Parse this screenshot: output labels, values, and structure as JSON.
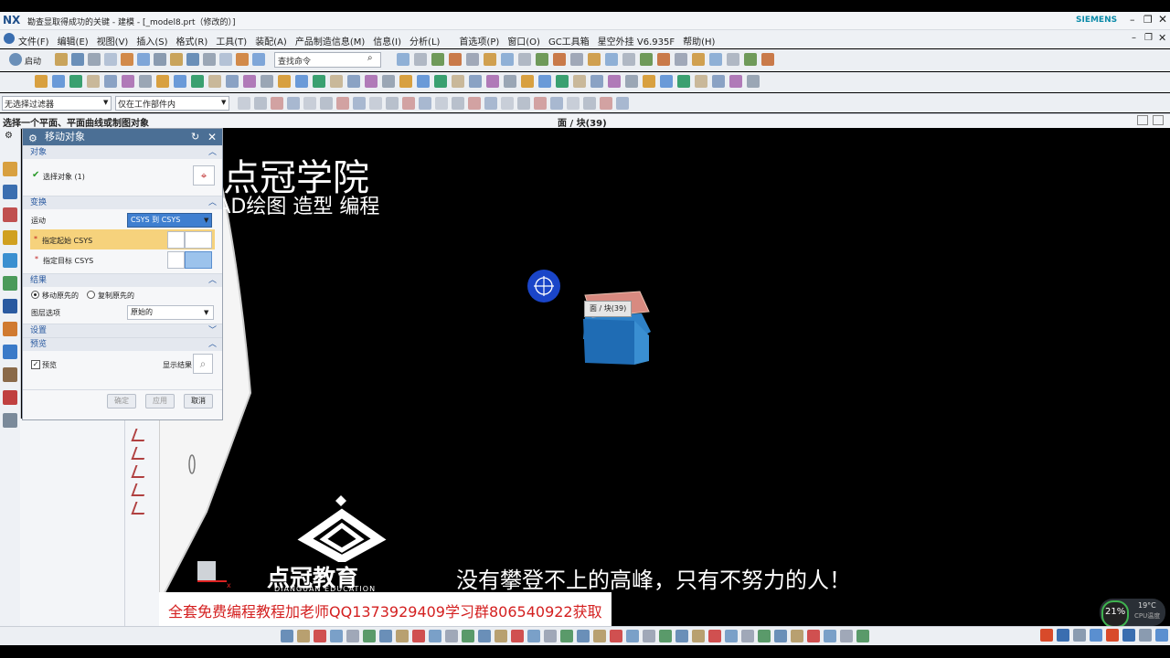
{
  "window": {
    "app_logo": "NX",
    "title": "勘查显取得成功的关键 - 建模 - [_model8.prt（修改的）]",
    "brand": "SIEMENS"
  },
  "menu": {
    "items": [
      "文件(F)",
      "编辑(E)",
      "视图(V)",
      "插入(S)",
      "格式(R)",
      "工具(T)",
      "装配(A)",
      "产品制造信息(M)",
      "信息(I)",
      "分析(L)",
      "首选项(P)",
      "窗口(O)",
      "GC工具箱",
      "星空外挂 V6.935F",
      "帮助(H)"
    ]
  },
  "toolbar": {
    "start_label": "启动",
    "search_placeholder": "查找命令",
    "filter_value": "无选择过滤器",
    "scope_value": "仅在工作部件内"
  },
  "status": {
    "prompt": "选择一个平面、平面曲线或制图对象",
    "selection_info": "面 / 块(39)"
  },
  "dialog": {
    "title": "移动对象",
    "sec_object": "对象",
    "select_object": "选择对象 (1)",
    "sec_transform": "变换",
    "motion_label": "运动",
    "motion_value": "CSYS 到 CSYS",
    "origin_csys": "指定起始 CSYS",
    "target_csys": "指定目标 CSYS",
    "sec_result": "结果",
    "move_original": "移动原先的",
    "copy_original": "复制原先的",
    "layer_label": "图层选项",
    "layer_value": "原始的",
    "sec_settings": "设置",
    "sec_preview": "预览",
    "preview_label": "预览",
    "show_result": "显示结果",
    "ok": "确定",
    "apply": "应用",
    "cancel": "取消"
  },
  "viewport": {
    "tooltip": "面 / 块(39)",
    "watermark_title": "点冠学院",
    "watermark_sub": "CAD绘图 造型 编程",
    "logo_text": "点冠教育",
    "logo_sub": "DIANGUAN EDUCATION",
    "slogan": "没有攀登不上的高峰，只有不努力的人！",
    "banner": "全套免费编程教程加老师QQ1373929409学习群806540922获取"
  },
  "tray": {
    "cpu_percent": "21%",
    "temp": "19°C",
    "cpu_label": "CPU温度"
  },
  "colors": {
    "accent": "#4b6f95",
    "cube_top": "#d88a80",
    "cube_body": "#2f82c8",
    "highlight": "#f6d27c"
  }
}
